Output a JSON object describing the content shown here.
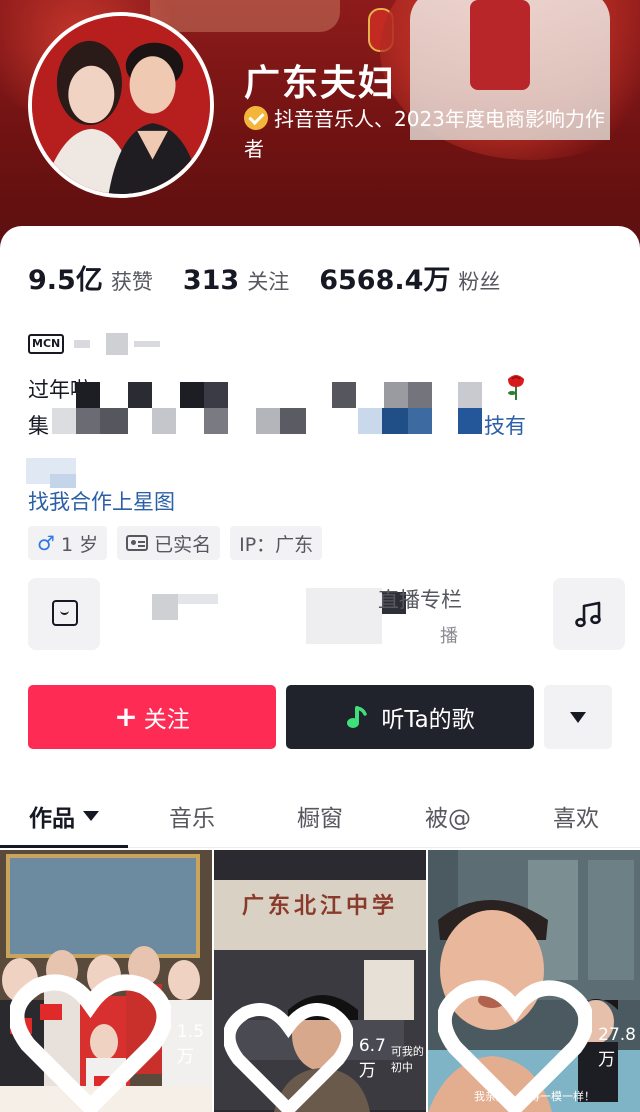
{
  "profile": {
    "nickname": "广东夫妇",
    "verified_text": "抖音音乐人、2023年度电商影响力作者"
  },
  "stats": [
    {
      "value": "9.5亿",
      "label": "获赞"
    },
    {
      "value": "313",
      "label": "关注"
    },
    {
      "value": "6568.4万",
      "label": "粉丝"
    }
  ],
  "bio": {
    "mcn_badge": "MCN",
    "line1_start": "过年啦",
    "line2_start": "集",
    "line2_end": "技有",
    "star_link": "找我合作上星图"
  },
  "tags": {
    "gender_age": "1  岁",
    "real_name": "已实名",
    "ip": "IP：广东"
  },
  "shortcuts": {
    "item2_title": "直播专栏",
    "item2_sub": "播"
  },
  "actions": {
    "follow": "关注",
    "listen": "听Ta的歌"
  },
  "tabs": [
    "作品",
    "音乐",
    "橱窗",
    "被@",
    "喜欢"
  ],
  "videos": [
    {
      "likes": "1.5万"
    },
    {
      "likes": "6.7万",
      "caption": "可我的初中",
      "sign_text": "广东北江中学"
    },
    {
      "likes": "27.8万",
      "caption": "我亲妹！长得一模一样！"
    }
  ],
  "colors": {
    "follow_button": "#fe2c55",
    "listen_button": "#20222c",
    "link": "#2b5fa6",
    "banner": "#8e1b1b"
  },
  "icons": [
    "verified-icon",
    "male-icon",
    "id-card-icon",
    "shop-bag-icon",
    "music-note-icon",
    "rose-icon",
    "heart-icon",
    "chevron-down-icon"
  ]
}
